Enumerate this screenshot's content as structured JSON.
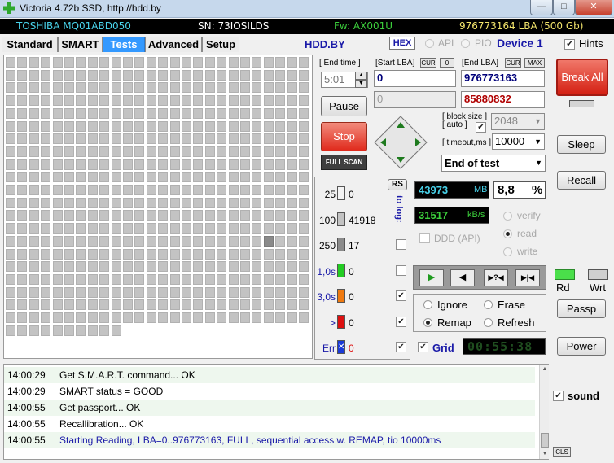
{
  "window": {
    "title": "Victoria 4.72b SSD, http://hdd.by",
    "minimize": "—",
    "maximize": "□",
    "close": "✕"
  },
  "drive": {
    "model": "TOSHIBA MQ01ABD050",
    "serial": "SN: 73IOSILDS",
    "firmware": "Fw: AX001U",
    "capacity": "976773164 LBA (500 Gb)"
  },
  "tabs": [
    "Standard",
    "SMART",
    "Tests",
    "Advanced",
    "Setup"
  ],
  "active_tab": "Tests",
  "header": {
    "site": "HDD.BY",
    "hex": "HEX",
    "api": "API",
    "pio": "PIO",
    "device": "Device 1",
    "hints": "Hints"
  },
  "surface_map": {
    "columns": 26,
    "full_rows": 21,
    "last_row_blocks": 10,
    "slow_block": {
      "row": 14,
      "col": 22
    }
  },
  "controls": {
    "end_time_label": "[ End time ]",
    "end_time_value": "5:01",
    "start_lba_label": "[Start LBA]",
    "cur_label": "CUR",
    "zero_label": "0",
    "start_lba_value": "0",
    "end_lba_label": "[End LBA]",
    "max_label": "MAX",
    "end_lba_value": "976773163",
    "pause": "Pause",
    "current_lba_value": "0",
    "current_lba2_value": "85880832",
    "stop": "Stop",
    "full_scan": "FULL SCAN",
    "block_size_label_1": "[ block size ]",
    "block_size_label_2": "[ auto ]",
    "block_size_value": "2048",
    "timeout_label": "[ timeout,ms ]",
    "timeout_value": "10000",
    "end_action": "End of test"
  },
  "legend": {
    "rs": "RS",
    "to_log": "to log:",
    "rows": [
      {
        "label": "25",
        "value": "0",
        "color": "#f4f4f4",
        "label_color": "#000000",
        "log": null
      },
      {
        "label": "100",
        "value": "41918",
        "color": "#c3c3c3",
        "label_color": "#000000",
        "log": null
      },
      {
        "label": "250",
        "value": "17",
        "color": "#8a8a8a",
        "label_color": "#000000",
        "log": false
      },
      {
        "label": "1,0s",
        "value": "0",
        "color": "#22cc22",
        "label_color": "#1a1aa8",
        "log": false
      },
      {
        "label": "3,0s",
        "value": "0",
        "color": "#f07a10",
        "label_color": "#1a1aa8",
        "log": true
      },
      {
        "label": ">",
        "value": "0",
        "color": "#dd1010",
        "label_color": "#1a1aa8",
        "log": true
      },
      {
        "label": "Err",
        "value": "0",
        "color": "#1a3ad8",
        "label_color": "#1a1aa8",
        "log": true
      }
    ]
  },
  "stats": {
    "mb_value": "43973",
    "mb_unit": "MB",
    "percent_value": "8,8",
    "percent_unit": "%",
    "speed_value": "31517",
    "speed_unit": "kB/s",
    "verify": "verify",
    "read": "read",
    "write": "write",
    "ddd": "DDD (API)"
  },
  "playback": {
    "play": "▶",
    "back": "◀",
    "jump": "▶?◀",
    "end": "▶|◀"
  },
  "mode": {
    "ignore": "Ignore",
    "erase": "Erase",
    "remap": "Remap",
    "refresh": "Refresh",
    "selected": "Remap",
    "grid": "Grid",
    "timer": "00:55:38"
  },
  "right_panel": {
    "break_all": "Break All",
    "sleep": "Sleep",
    "recall": "Recall",
    "rd": "Rd",
    "wrt": "Wrt",
    "passp": "Passp",
    "power": "Power",
    "sound": "sound",
    "cls": "CLS"
  },
  "log": [
    {
      "time": "14:00:29",
      "msg": "Get S.M.A.R.T. command... OK",
      "color": "#000000"
    },
    {
      "time": "14:00:29",
      "msg": "SMART status = GOOD",
      "color": "#000000"
    },
    {
      "time": "14:00:55",
      "msg": "Get passport... OK",
      "color": "#000000"
    },
    {
      "time": "14:00:55",
      "msg": "Recallibration... OK",
      "color": "#000000"
    },
    {
      "time": "14:00:55",
      "msg": "Starting Reading, LBA=0..976773163, FULL, sequential access w. REMAP, tio 10000ms",
      "color": "#1a1aa8"
    }
  ]
}
